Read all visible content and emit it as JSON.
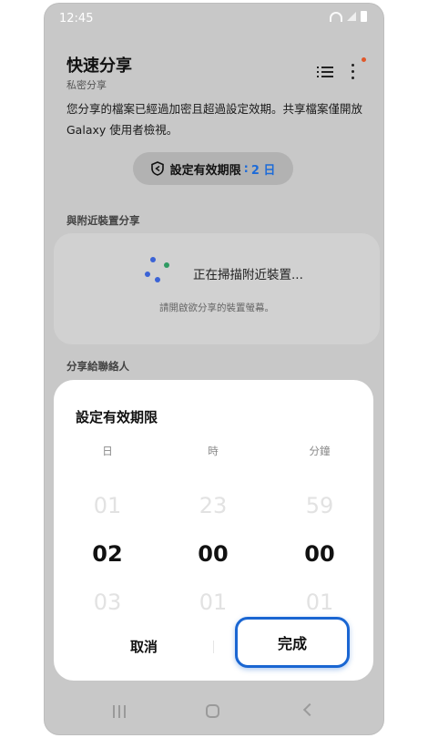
{
  "status_bar": {
    "time": "12:45"
  },
  "header": {
    "title": "快速分享",
    "subtitle": "私密分享"
  },
  "description": "您分享的檔案已經過加密且超過設定效期。共享檔案僅開放 Galaxy 使用者檢視。",
  "expiry": {
    "label": "設定有效期限",
    "separator": " : ",
    "value": "2 日"
  },
  "nearby": {
    "section_label": "與附近裝置分享",
    "scanning_text": "正在掃描附近裝置...",
    "hint": "請開啟欲分享的裝置螢幕。"
  },
  "contacts": {
    "section_label": "分享給聯絡人"
  },
  "dialog": {
    "title": "設定有效期限",
    "columns": [
      {
        "label": "日",
        "prev": "01",
        "current": "02",
        "next": "03"
      },
      {
        "label": "時",
        "prev": "23",
        "current": "00",
        "next": "01"
      },
      {
        "label": "分鐘",
        "prev": "59",
        "current": "00",
        "next": "01"
      }
    ],
    "cancel_label": "取消",
    "done_label": "完成"
  },
  "colors": {
    "accent": "#1d6bd8",
    "highlight_border": "#1a66d2",
    "notification_dot": "#e0582a"
  },
  "icons": {
    "header_list": "list-icon",
    "header_more": "more-vertical-icon",
    "expiry": "shield-share-icon",
    "nav": [
      "recents-icon",
      "home-icon",
      "back-icon"
    ]
  }
}
